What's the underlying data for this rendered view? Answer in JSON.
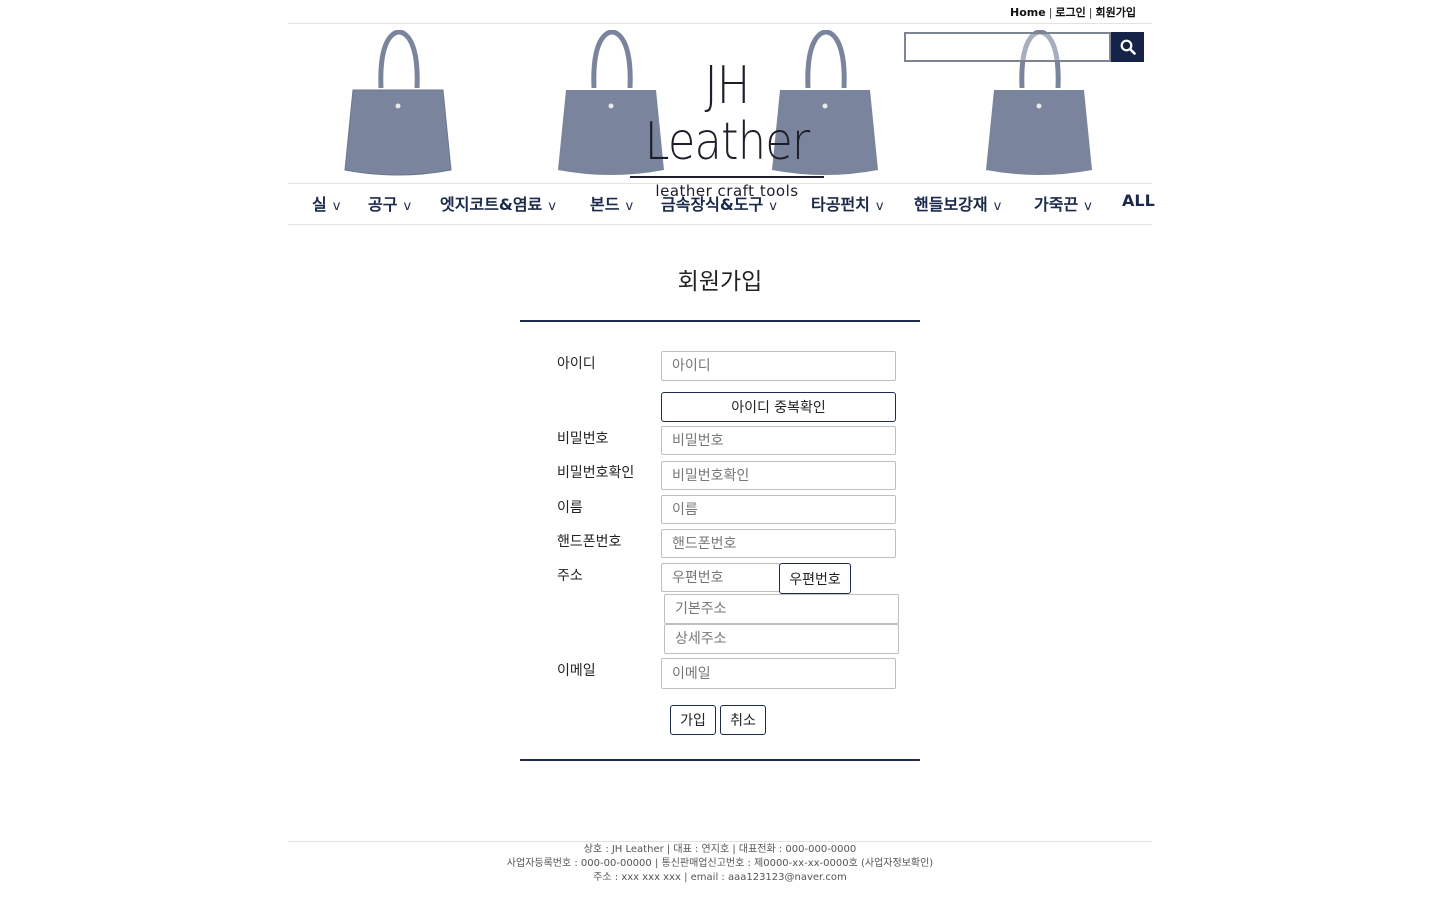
{
  "header": {
    "links": [
      "Home",
      "로그인",
      "회원가입"
    ],
    "logo": {
      "title": "JH Leather",
      "subtitle": "leather craft tools"
    },
    "search": {
      "placeholder": ""
    }
  },
  "nav": {
    "items": [
      "실",
      "공구",
      "엣지코트&염료",
      "본드",
      "금속장식&도구",
      "타공펀치",
      "핸들보강재",
      "가죽끈",
      "ALL"
    ],
    "chevron": "v"
  },
  "form": {
    "title": "회원가입",
    "id_label": "아이디",
    "id_placeholder": "아이디",
    "check_id_button": "아이디 중복확인",
    "password_label": "비밀번호",
    "password_placeholder": "비밀번호",
    "password_confirm_label": "비밀번호확인",
    "password_confirm_placeholder": "비밀번호확인",
    "name_label": "이름",
    "name_placeholder": "이름",
    "phone_label": "핸드폰번호",
    "phone_placeholder": "핸드폰번호",
    "address_label": "주소",
    "zipcode_placeholder": "우편번호",
    "zipcode_button": "우편번호",
    "address_placeholder": "기본주소",
    "address_detail_placeholder": "상세주소",
    "email_label": "이메일",
    "email_placeholder": "이메일",
    "submit_button": "가입",
    "cancel_button": "취소"
  },
  "footer": {
    "line1": "상호 : JH Leather | 대표 : 연지호 | 대표전화 : 000-000-0000",
    "line2": "사업자등록번호 : 000-00-00000 | 통신판매업신고번호 : 제0000-xx-xx-0000호 (사업자정보확인)",
    "line3": "주소 : xxx xxx xxx | email : aaa123123@naver.com"
  },
  "colors": {
    "navy": "#1e2b4d",
    "search_button": "#152349",
    "bag": "#7a849c"
  }
}
